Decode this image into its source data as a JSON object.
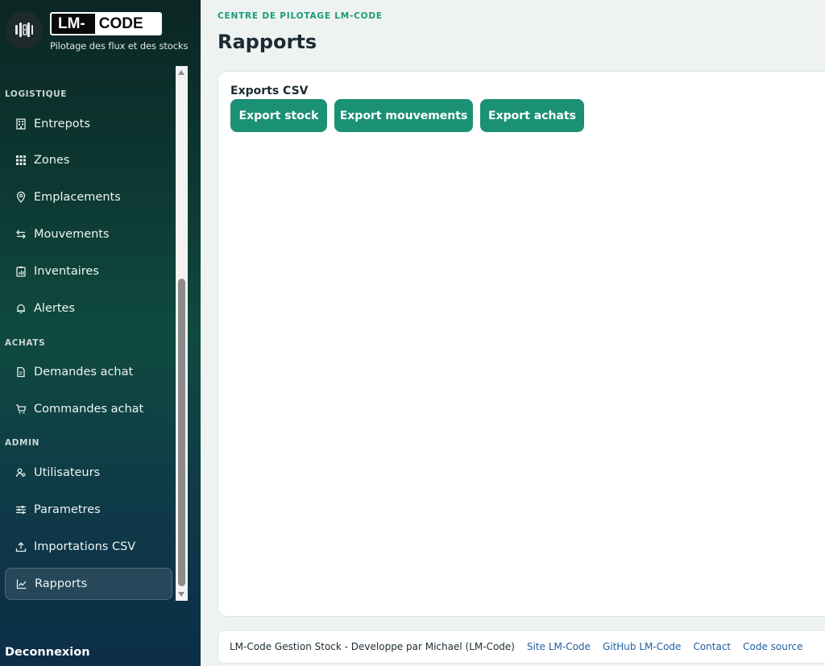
{
  "brand": {
    "logo_left": "LM-",
    "logo_right": "CODE",
    "tagline": "Pilotage des flux et des stocks"
  },
  "sidebar": {
    "sections": [
      {
        "label": "LOGISTIQUE"
      },
      {
        "label": "ACHATS"
      },
      {
        "label": "ADMIN"
      }
    ],
    "items": [
      {
        "label": "Entrepots",
        "icon": "building-icon"
      },
      {
        "label": "Zones",
        "icon": "grid-icon"
      },
      {
        "label": "Emplacements",
        "icon": "map-pin-icon"
      },
      {
        "label": "Mouvements",
        "icon": "arrows-swap-icon"
      },
      {
        "label": "Inventaires",
        "icon": "clipboard-chart-icon"
      },
      {
        "label": "Alertes",
        "icon": "bell-icon"
      },
      {
        "label": "Demandes achat",
        "icon": "document-icon"
      },
      {
        "label": "Commandes achat",
        "icon": "cart-icon"
      },
      {
        "label": "Utilisateurs",
        "icon": "users-icon"
      },
      {
        "label": "Parametres",
        "icon": "sliders-icon"
      },
      {
        "label": "Importations CSV",
        "icon": "upload-icon"
      },
      {
        "label": "Rapports",
        "icon": "chart-line-icon",
        "active": true
      }
    ],
    "logout_label": "Deconnexion"
  },
  "header": {
    "eyebrow": "CENTRE DE PILOTAGE LM-CODE",
    "title": "Rapports"
  },
  "exports": {
    "title": "Exports CSV",
    "buttons": [
      {
        "label": "Export stock"
      },
      {
        "label": "Export mouvements"
      },
      {
        "label": "Export achats"
      }
    ]
  },
  "footer": {
    "credit": "LM-Code Gestion Stock - Developpe par Michael (LM-Code)",
    "links": [
      {
        "label": "Site LM-Code"
      },
      {
        "label": "GitHub LM-Code"
      },
      {
        "label": "Contact"
      },
      {
        "label": "Code source"
      }
    ]
  },
  "colors": {
    "accent": "#1a9075",
    "eyebrow": "#1a9a7a",
    "link": "#1f5fa0",
    "sidebar_top": "#0b2624",
    "sidebar_bottom": "#0c2e47"
  }
}
